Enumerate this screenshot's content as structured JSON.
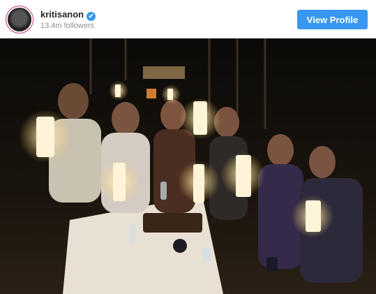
{
  "profile": {
    "username": "kritisanon",
    "verified_icon": "verified-badge-icon",
    "followers": "13.4m followers",
    "view_profile_label": "View Profile",
    "accent_color": "#3897f0"
  },
  "post": {
    "image_description_icon": "photo-image"
  }
}
